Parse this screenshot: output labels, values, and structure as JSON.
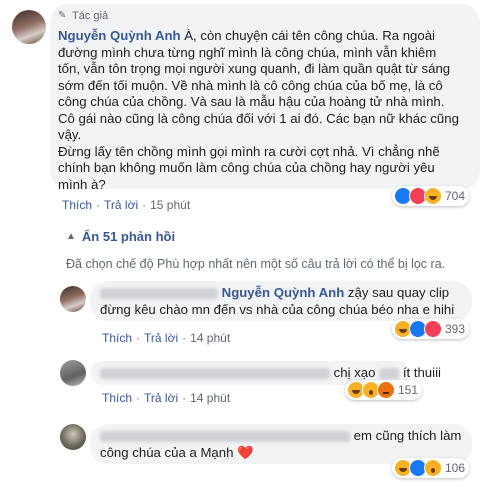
{
  "main_comment": {
    "badge": "Tác giả",
    "author": "Nguyễn Quỳnh Anh",
    "lines": [
      " À, còn chuyện cái tên công chúa. Ra ngoài",
      "đường mình chưa từng nghĩ mình là công chúa, mình vẫn khiêm",
      "tốn, vẫn tôn trọng mọi người xung quanh, đi làm quần quật từ sáng",
      "sớm đến tối muộn. Về nhà mình là cô công chúa của bố mẹ, là cô",
      "công chúa của chồng. Và sau là mẫu hậu của hoàng tử nhà mình.",
      "Cô gái nào cũng là công chúa đối với 1 ai đó. Các bạn nữ khác cũng",
      "vậy.",
      "Đừng lấy tên chồng mình gọi mình ra cười cợt nhả. Vì chẳng nhẽ",
      "chính bạn không muốn làm công chúa của chồng hay người yêu",
      "mình à?"
    ],
    "reaction_count": "704",
    "actions": {
      "like": "Thích",
      "reply": "Trả lời",
      "time": "15 phút"
    }
  },
  "hide_replies": "Ẩn 51 phản hồi",
  "filter_notice": "Đã chọn chế độ Phù hợp nhất nên một số câu trả lời có thể bị lọc ra.",
  "replies": [
    {
      "author": "Nguyễn Quỳnh Anh",
      "text_after": " zậy sau quay clip",
      "line2": "đừng kêu chào mn đến vs nhà của công chúa béo nha e hihi",
      "reaction_count": "393",
      "actions": {
        "like": "Thích",
        "reply": "Trả lời",
        "time": "14 phút"
      }
    },
    {
      "text_mid": "chị xạo",
      "text_end": "ít thuiii",
      "reaction_count": "151",
      "actions": {
        "like": "Thích",
        "reply": "Trả lời",
        "time": "14 phút"
      }
    },
    {
      "text_after": "em cũng thích làm",
      "line2": "công chúa của a Mạnh",
      "heart": "❤️",
      "reaction_count": "106",
      "actions": {}
    }
  ]
}
